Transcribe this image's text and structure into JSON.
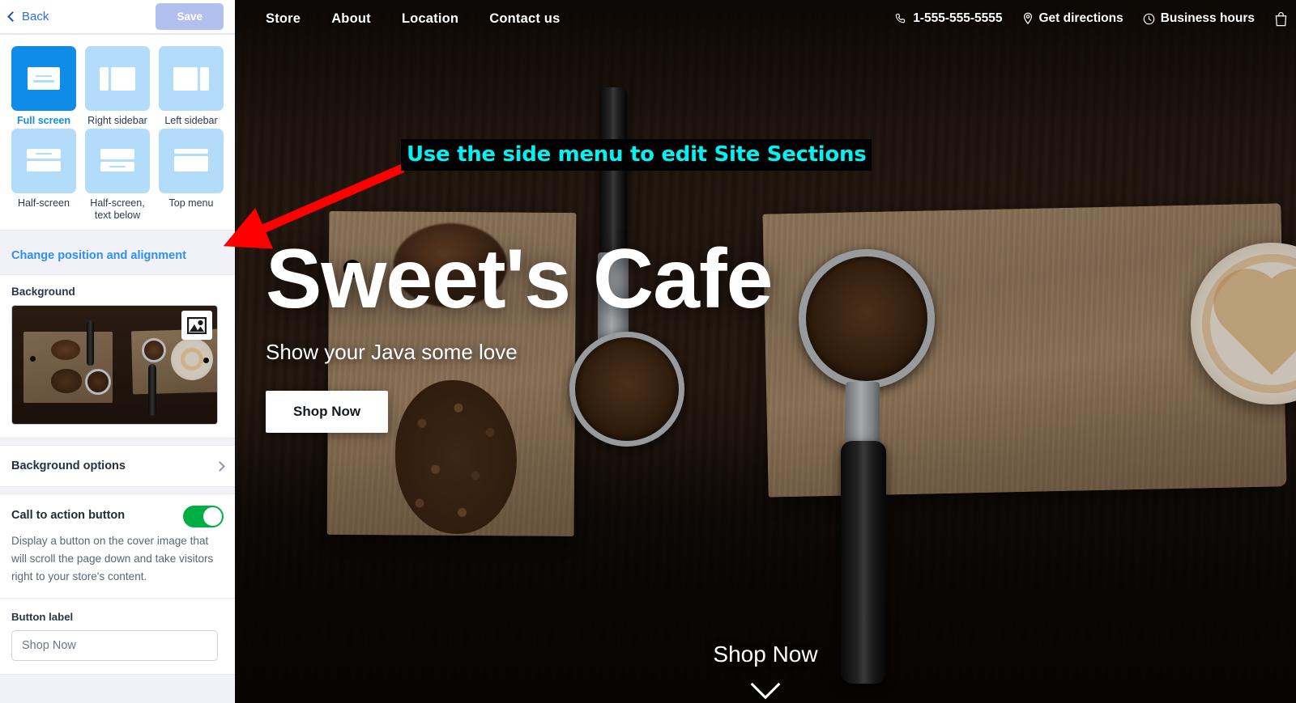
{
  "editor": {
    "header": {
      "back_label": "Back",
      "back_icon": "chevron-left-icon",
      "save_label": "Save"
    },
    "layout_section": {
      "options": [
        {
          "label": "Full screen",
          "icon": "layout-full-screen-icon",
          "selected": true
        },
        {
          "label": "Right sidebar",
          "icon": "layout-right-sidebar-icon",
          "selected": false
        },
        {
          "label": "Left sidebar",
          "icon": "layout-left-sidebar-icon",
          "selected": false
        },
        {
          "label": "Half-screen",
          "icon": "layout-half-screen-icon",
          "selected": false
        },
        {
          "label": "Half-screen,\ntext below",
          "icon": "layout-half-screen-text-below-icon",
          "selected": false
        },
        {
          "label": "Top menu",
          "icon": "layout-top-menu-icon",
          "selected": false
        }
      ]
    },
    "position_link": "Change position and alignment",
    "background_section": {
      "label": "Background",
      "thumbnail_badge_icon": "image-icon"
    },
    "background_options": {
      "label": "Background options",
      "chevron_icon": "chevron-right-icon"
    },
    "cta_section": {
      "title": "Call to action button",
      "toggle_state": "on",
      "toggle_color": "#00af41",
      "description": "Display a button on the cover image that will scroll the page down and take visitors right to your store's content.",
      "button_label_field": {
        "label": "Button label",
        "value": "Shop Now",
        "placeholder": "Shop Now"
      }
    }
  },
  "preview": {
    "nav": {
      "links": [
        {
          "label": "Store"
        },
        {
          "label": "About"
        },
        {
          "label": "Location"
        },
        {
          "label": "Contact us"
        }
      ],
      "info": [
        {
          "label": "1-555-555-5555",
          "icon": "phone-icon"
        },
        {
          "label": "Get directions",
          "icon": "map-pin-icon"
        },
        {
          "label": "Business hours",
          "icon": "clock-icon"
        }
      ],
      "cart_icon": "shopping-bag-icon"
    },
    "hero": {
      "title": "Sweet's Cafe",
      "subtitle": "Show your Java some love",
      "cta_label": "Shop Now"
    },
    "scroll_cue": {
      "label": "Shop Now",
      "icon": "chevron-down-icon"
    }
  },
  "annotation": {
    "text": "Use the side menu to edit Site Sections",
    "text_color": "#00f2f2",
    "background_color": "#000000",
    "arrow_color": "#ff0000"
  }
}
